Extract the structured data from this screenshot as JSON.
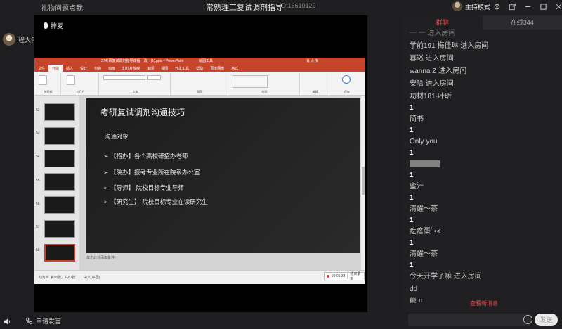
{
  "titlebar": {
    "gift_link": "礼物问题点我",
    "room_title": "常熟理工复试调剂指导",
    "room_id": "ID:16610129",
    "host_mode": "主持模式",
    "icons": [
      "gear-icon",
      "share-icon",
      "minimize-icon",
      "restore-icon",
      "close-icon"
    ]
  },
  "teacher": {
    "name": "程大伟"
  },
  "stage": {
    "mic_label": "排麦"
  },
  "ppt": {
    "window_title": "37考研复试调剂指导课程（改）(1).pptx - PowerPoint",
    "context_tab": "绘图工具",
    "user": "肖 大伟",
    "tabs": [
      "文件",
      "开始",
      "插入",
      "设计",
      "切换",
      "动画",
      "幻灯片放映",
      "审阅",
      "视图",
      "开发工具",
      "帮助",
      "百度网盘",
      "格式"
    ],
    "ribbon_groups": [
      "剪贴板",
      "幻灯片",
      "字体",
      "段落",
      "绘图",
      "编辑",
      "保存"
    ],
    "thumb_numbers": [
      "52",
      "53",
      "54",
      "55",
      "56",
      "57",
      "58"
    ],
    "notes_placeholder": "单击此处添加备注",
    "status_slide": "幻灯片 第58张，共81张",
    "status_lang": "中文(中国)",
    "rec_time": "00:01:38",
    "rec_stop": "结束录制"
  },
  "slide": {
    "title": "考研复试调剂沟通技巧",
    "subtitle": "沟通对象",
    "bullets": [
      "【招办】各个高校研招办老师",
      "【院办】报考专业所在院系办公室",
      "【导师】 院校目标专业导师",
      "【研究生】 院校目标专业在读研究生"
    ]
  },
  "chat": {
    "tabs": [
      "群聊",
      "在线344"
    ],
    "messages": [
      "一 一 进入房间",
      "学前191 梅佳琳 进入房间",
      "暮巡 进入房间",
      "wanna Z 进入房间",
      "安哈 进入房间",
      "功材181-叶昕",
      "1",
      "简书",
      "1",
      "Only you",
      "1",
      "",
      "1",
      "蜜汁",
      "1",
      "清醒～茶",
      "1",
      "疙瘩蛋ﾟ•˂",
      "1",
      "清醒～茶",
      "1",
      "今天开学了嘛 进入房间",
      "dd",
      "熊 !!"
    ],
    "new_messages": "查看新消息",
    "send": "发送"
  },
  "bottom": {
    "apply_speak": "申请发言"
  },
  "colors": {
    "accent": "#e3464a",
    "ppt": "#c6452a"
  }
}
